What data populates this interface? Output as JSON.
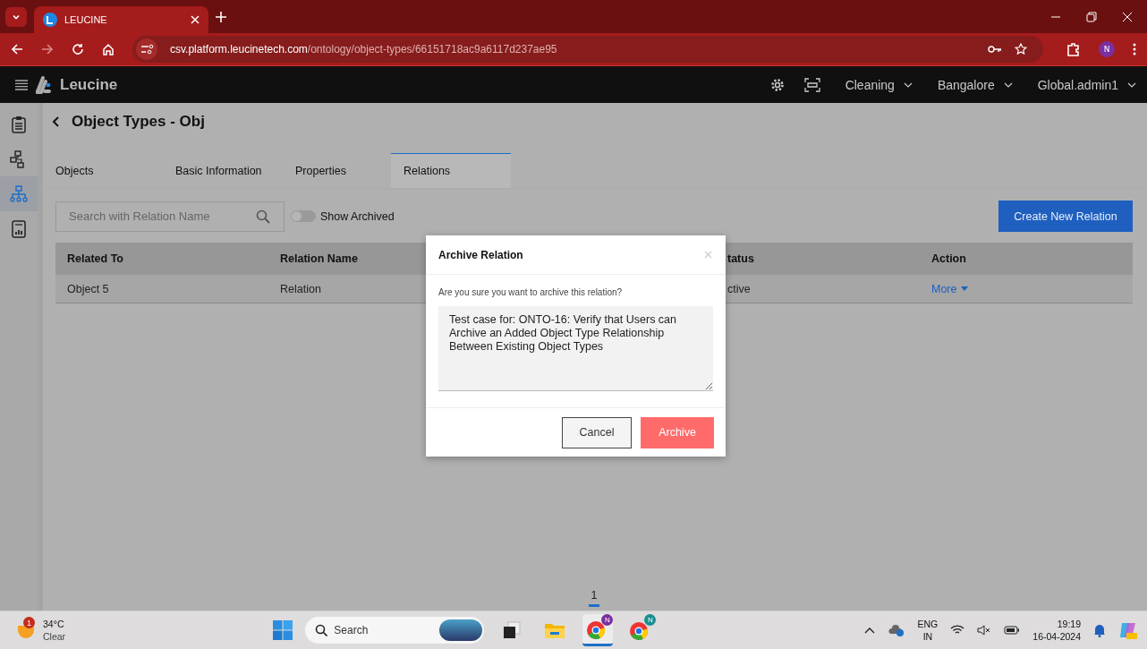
{
  "browser": {
    "tab_title": "LEUCINE",
    "url_host": "csv.platform.leucinetech.com",
    "url_path": "/ontology/object-types/66151718ac9a6117d237ae95",
    "profile_initial": "N"
  },
  "app_header": {
    "brand": "Leucine",
    "dropdowns": [
      "Cleaning",
      "Bangalore",
      "Global.admin1"
    ]
  },
  "sidebar": {
    "items": [
      {
        "kind": "checklist",
        "selected": false
      },
      {
        "kind": "flow",
        "selected": false
      },
      {
        "kind": "hierarchy",
        "selected": true
      },
      {
        "kind": "report",
        "selected": false
      }
    ]
  },
  "page": {
    "title": "Object Types - Obj",
    "tabs": [
      {
        "label": "Objects",
        "selected": false
      },
      {
        "label": "Basic Information",
        "selected": false
      },
      {
        "label": "Properties",
        "selected": false
      },
      {
        "label": "Relations",
        "selected": true
      }
    ],
    "search": {
      "placeholder": "Search with Relation Name"
    },
    "toggle": {
      "label": "Show Archived",
      "on": false
    },
    "create_button": "Create New Relation",
    "table": {
      "columns": [
        "Related To",
        "Relation Name",
        "tatus",
        "Action"
      ],
      "rows": [
        {
          "cells": [
            "Object 5",
            "Relation",
            "ctive"
          ],
          "action": "More"
        }
      ]
    },
    "pagination": [
      {
        "label": "1",
        "selected": true
      }
    ]
  },
  "dialog": {
    "title": "Archive Relation",
    "message": "Are you sure you want to archive this relation?",
    "reason": "Test case for: ONTO-16: Verify that Users can Archive an Added Object Type Relationship Between Existing Object Types",
    "cancel": "Cancel",
    "confirm": "Archive"
  },
  "taskbar": {
    "weather": {
      "badge": "1",
      "temperature": "34°C",
      "condition": "Clear"
    },
    "search_placeholder": "Search",
    "apps": [
      {
        "kind": "taskview",
        "selected": false
      },
      {
        "kind": "folder",
        "selected": false
      },
      {
        "kind": "browser",
        "badge": "N",
        "color": "#7b2fa0",
        "selected": true
      },
      {
        "kind": "browser",
        "badge": "N",
        "color": "#1a8f8f",
        "selected": false
      }
    ],
    "language": [
      "ENG",
      "IN"
    ],
    "time": "19:19",
    "date": "16-04-2024"
  }
}
